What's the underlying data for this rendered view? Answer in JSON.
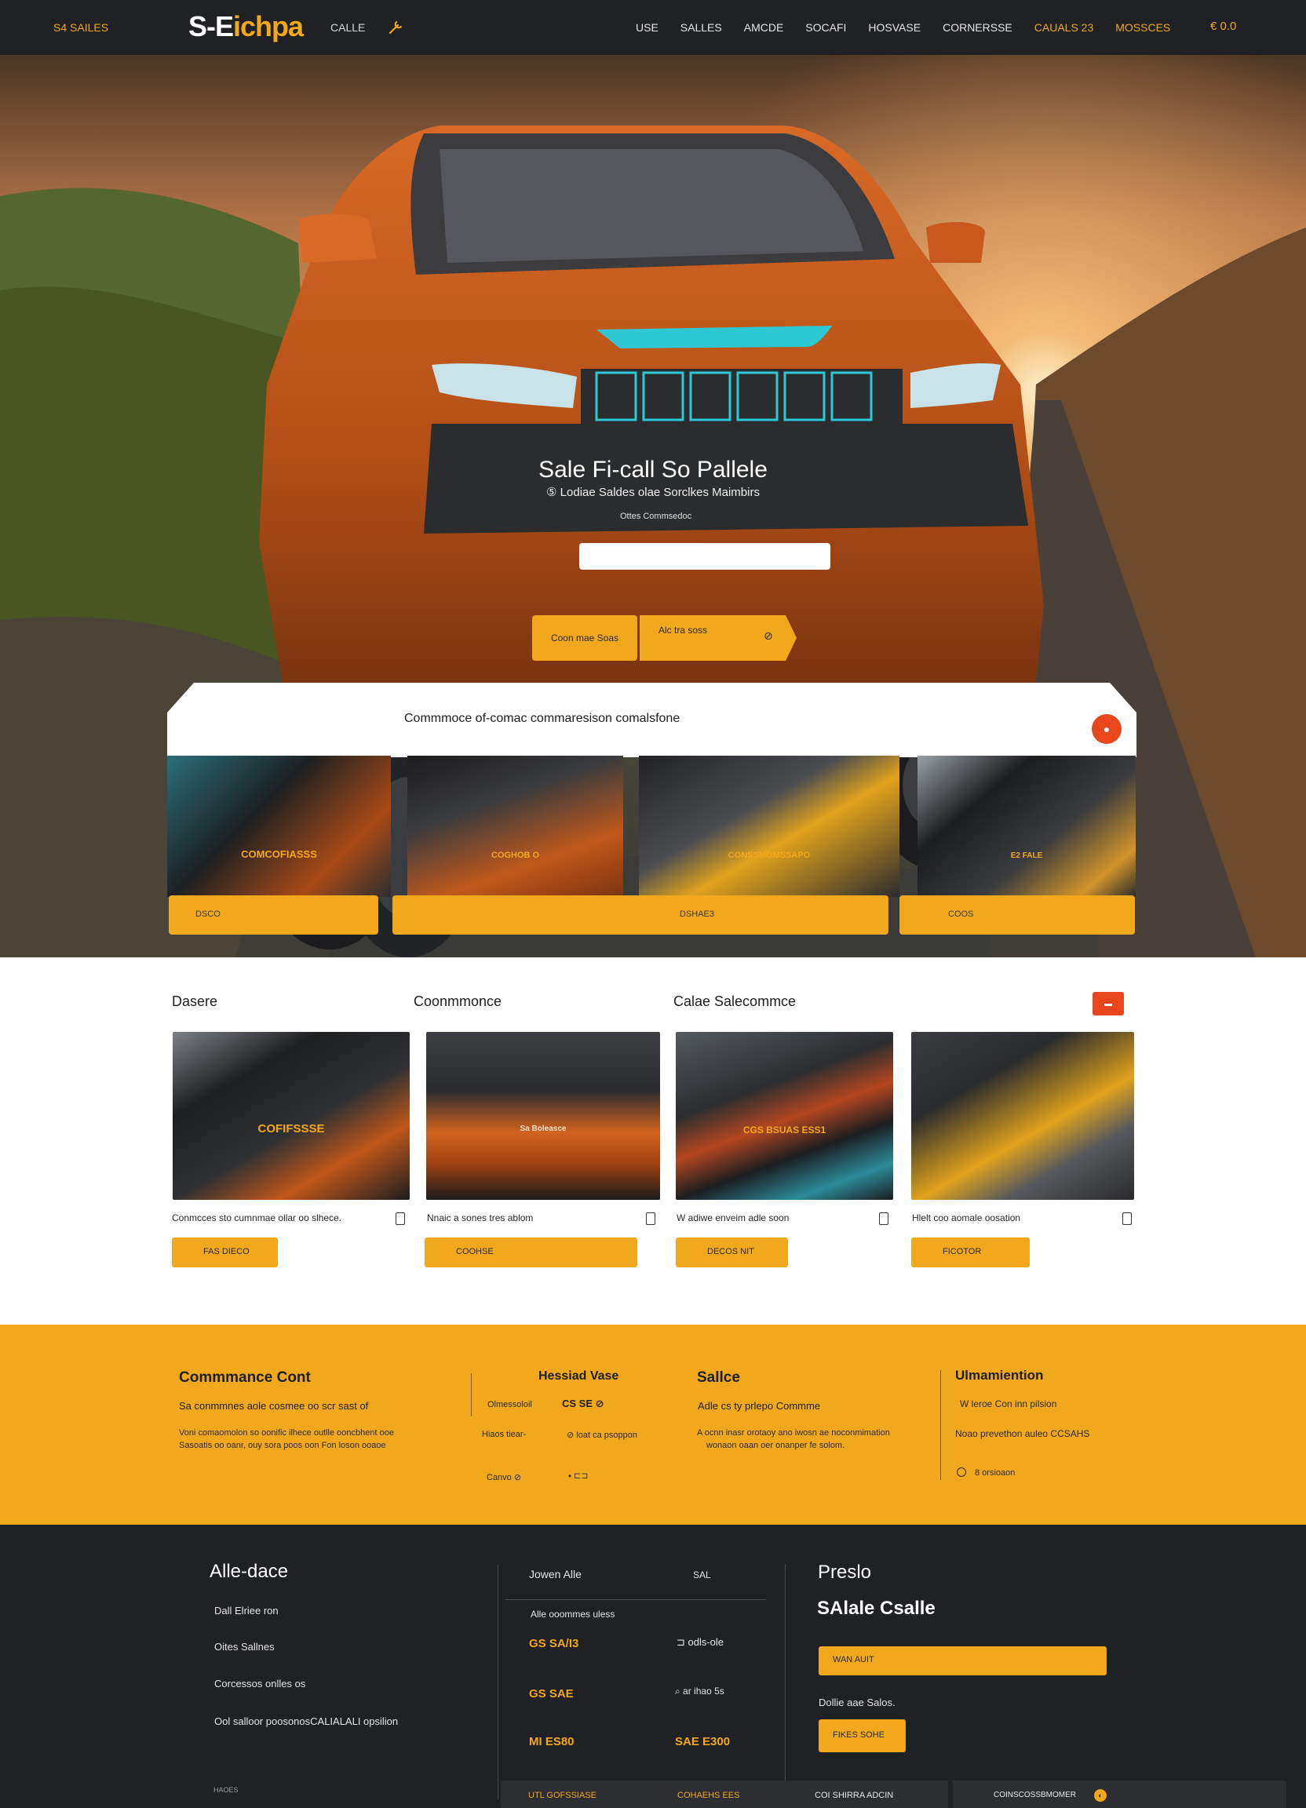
{
  "topnav": {
    "promo": "S4 SAILES",
    "logo_main": "S-E",
    "logo_accent": "ichpa",
    "logo_sub": "CALLE",
    "links": [
      {
        "label": "USE",
        "accent": false
      },
      {
        "label": "SALLES",
        "accent": false
      },
      {
        "label": "AMCDE",
        "accent": false
      },
      {
        "label": "SOCAFI",
        "accent": false
      },
      {
        "label": "HOSVASE",
        "accent": false
      },
      {
        "label": "CORNERSSE",
        "accent": false
      },
      {
        "label": "CAUALS 23",
        "accent": true
      },
      {
        "label": "MOSSCES",
        "accent": true
      }
    ],
    "cart": "€ 0.0"
  },
  "hero": {
    "headline": "Sale Fi-call So Pallele",
    "subline": "⑤ Lodiae Saldes  olae Sorclkes  Maimbirs",
    "tinyline": "Ottes Commsedoc",
    "search_placeholder": "",
    "btn_primary": "Coon mae Soas",
    "btn_secondary": "Alc tra soss",
    "btn_secondary_icon": "⊘"
  },
  "card": {
    "title": "Commmoce of-comac commaresison comalsfone",
    "badge": "●",
    "thumbs": [
      {
        "caption": "COMCOFIASSS"
      },
      {
        "caption": "COGHOB O"
      },
      {
        "caption": "CONSSMOMSSAPO"
      },
      {
        "caption": "E2 FALE"
      }
    ],
    "bars": [
      {
        "label": "DSCO"
      },
      {
        "label": "DSHAE3"
      },
      {
        "label": "COOS"
      }
    ]
  },
  "section2": {
    "headings": [
      "Dasere",
      "Coonmmonce",
      "Calae Salecommce"
    ],
    "button_label": "▬",
    "products": [
      {
        "caption": "COFIFSSSE",
        "desc": "Conmcces sto cumnmae ollar oo slhece.",
        "btn": "FAS DIECO"
      },
      {
        "caption": "Sa Boleasce",
        "desc": "Nnaic a sones tres ablom",
        "btn": "COOHSE"
      },
      {
        "caption": "CGS BSUAS ESS1",
        "desc": "W adiwe enveim adle soon",
        "btn": "DECOS NIT"
      },
      {
        "caption": "",
        "desc": "Hlelt coo aomale oosation",
        "btn": "FICOTOR"
      }
    ]
  },
  "band": {
    "col1_title": "Commmance Cont",
    "col1_sub": "Sa conmmnes aole cosmee oo scr sast of",
    "col1_body1": "Voni comaomolon so oonific ilhece outlle ooncbhent ooe",
    "col1_body2": "Sasoatis oo oanr, ouy sora poos oon Fon loson ooaoe",
    "col2_title": "Hessiad Vase",
    "col2_r1_label": "Olmessoloil",
    "col2_r1_value": "CS SE ⊘",
    "col2_r2_label": "Hiaos tiear-",
    "col2_r2_value": "⊘ loat ca psoppon",
    "col2_r3_label": "Canvo ⊘",
    "col2_r3_value": "⬩  ⊏⊐",
    "col3_title": "Sallce",
    "col3_sub": "Adle cs ty prlepo Commme",
    "col3_body1": "A ocnn inasr orotaoy ano iwosn ae noconmimation",
    "col3_body2": "wonaon oaan oer onanper fe solom.",
    "col4_title": "Ulmamiention",
    "col4_sub": "W leroe Con inn pilsion",
    "col4_body": "Noao prevethon auleo CCSAHS",
    "col4_radio": "8 orsioaon"
  },
  "footer": {
    "col1_title": "Alle-dace",
    "col1_links": [
      "Dall Elriee ron",
      "Oites Sallnes",
      "Corcessos onlles os",
      "Ool salloor poosonosCALIALALI opsilion"
    ],
    "col1_small": "HAOES",
    "col2_title": "Jowen Alle",
    "col2_side": "SAL",
    "col2_sub": "Alle ooommes uless",
    "col2_items": [
      {
        "v": "GS SA/I3",
        "n": "⊐ odls-ole"
      },
      {
        "v": "GS SAE",
        "n": "⌕  ar ihao  5s"
      },
      {
        "v": "MI ES80",
        "n": "SAE E300"
      }
    ],
    "col3_title": "Preslo",
    "col3_big": "SAlale Csalle",
    "col3_input": "WAN AUIT",
    "col3_text": "Dollie aae Salos.",
    "col3_btn": "FIKES SOHE",
    "bottom": [
      "UTL GOFSSIASE",
      "COHAEHS EES",
      "COI SHIRRA ADCIN",
      "COINSCOSSBMOMER",
      "◐"
    ]
  },
  "colors": {
    "accent": "#f2a81d",
    "dark": "#1f2124",
    "red": "#e8461c"
  }
}
